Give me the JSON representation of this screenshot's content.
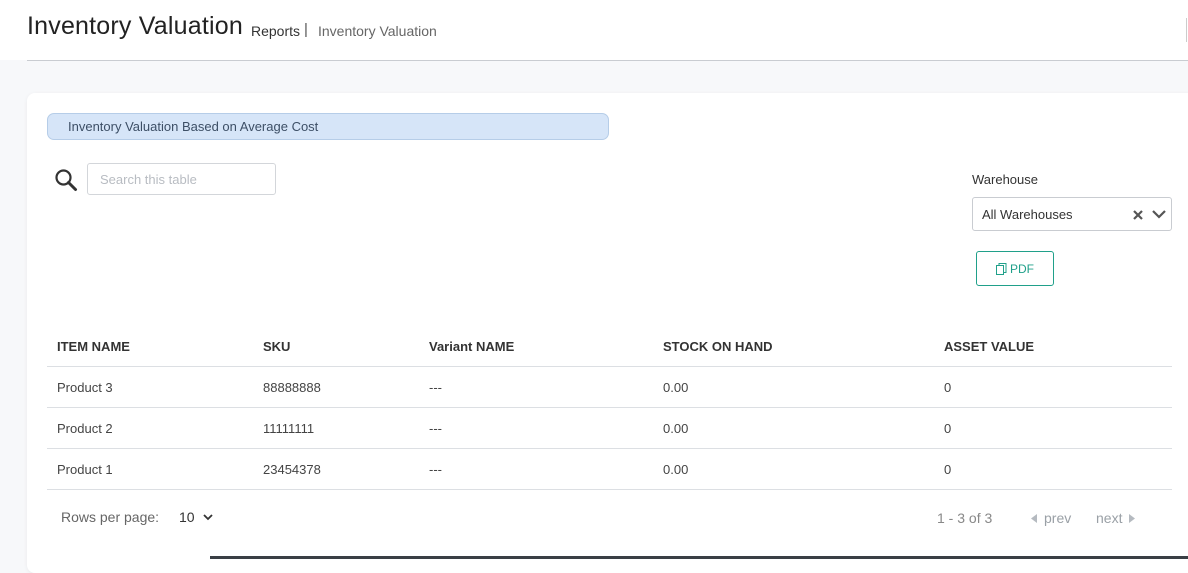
{
  "header": {
    "title": "Inventory Valuation",
    "breadcrumb": {
      "reports": "Reports",
      "separator": "|",
      "current": "Inventory Valuation"
    }
  },
  "banner": {
    "text": "Inventory Valuation Based on Average Cost"
  },
  "search": {
    "placeholder": "Search this table",
    "value": "",
    "icon": "search-icon"
  },
  "warehouse": {
    "label": "Warehouse",
    "selected": "All Warehouses",
    "clear_icon": "close-icon",
    "dropdown_icon": "chevron-down-icon"
  },
  "export": {
    "pdf_label": "PDF",
    "icon": "document-icon"
  },
  "table": {
    "columns": [
      "ITEM NAME",
      "SKU",
      "Variant NAME",
      "STOCK ON HAND",
      "ASSET VALUE"
    ],
    "rows": [
      [
        "Product 3",
        "88888888",
        "---",
        "0.00",
        "0"
      ],
      [
        "Product 2",
        "11111111",
        "---",
        "0.00",
        "0"
      ],
      [
        "Product 1",
        "23454378",
        "---",
        "0.00",
        "0"
      ]
    ]
  },
  "pagination": {
    "rows_per_page_label": "Rows per page:",
    "rows_per_page": "10",
    "range": "1 - 3 of 3",
    "prev": "prev",
    "next": "next"
  },
  "colors": {
    "accent": "#20a08a",
    "banner_bg": "#d6e5f8"
  }
}
